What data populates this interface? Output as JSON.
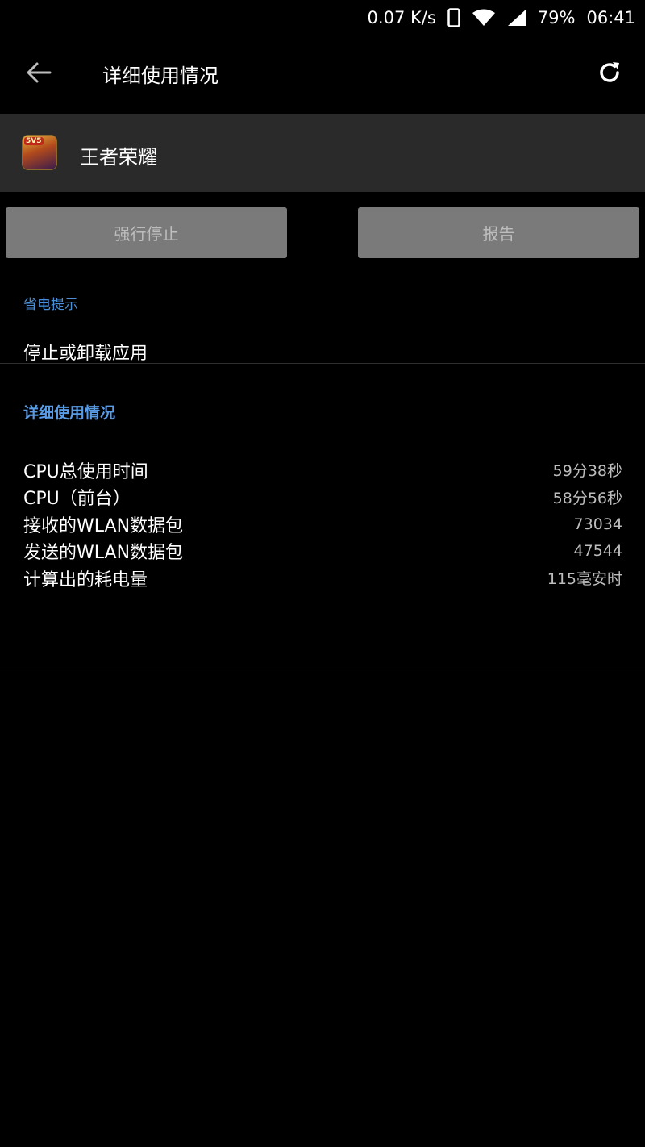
{
  "status_bar": {
    "network_speed": "0.07 K/s",
    "battery": "79%",
    "time": "06:41",
    "icons": [
      "phone-icon",
      "wifi-icon",
      "signal-icon"
    ]
  },
  "toolbar": {
    "title": "详细使用情况",
    "back_icon": "arrow-left-icon",
    "refresh_icon": "refresh-icon"
  },
  "app": {
    "name": "王者荣耀",
    "icon_badge": "5V5"
  },
  "buttons": {
    "force_stop": "强行停止",
    "report": "报告"
  },
  "power_tips": {
    "header": "省电提示",
    "item": "停止或卸载应用"
  },
  "usage_details": {
    "header": "详细使用情况",
    "rows": [
      {
        "label": "CPU总使用时间",
        "value": "59分38秒"
      },
      {
        "label": "CPU（前台）",
        "value": "58分56秒"
      },
      {
        "label": "接收的WLAN数据包",
        "value": "73034"
      },
      {
        "label": "发送的WLAN数据包",
        "value": "47544"
      },
      {
        "label": "计算出的耗电量",
        "value": "115毫安时"
      }
    ]
  },
  "colors": {
    "background": "#000000",
    "header_bg": "#2a2a2a",
    "button_bg": "#7a7a7a",
    "accent": "#4a90d9"
  }
}
